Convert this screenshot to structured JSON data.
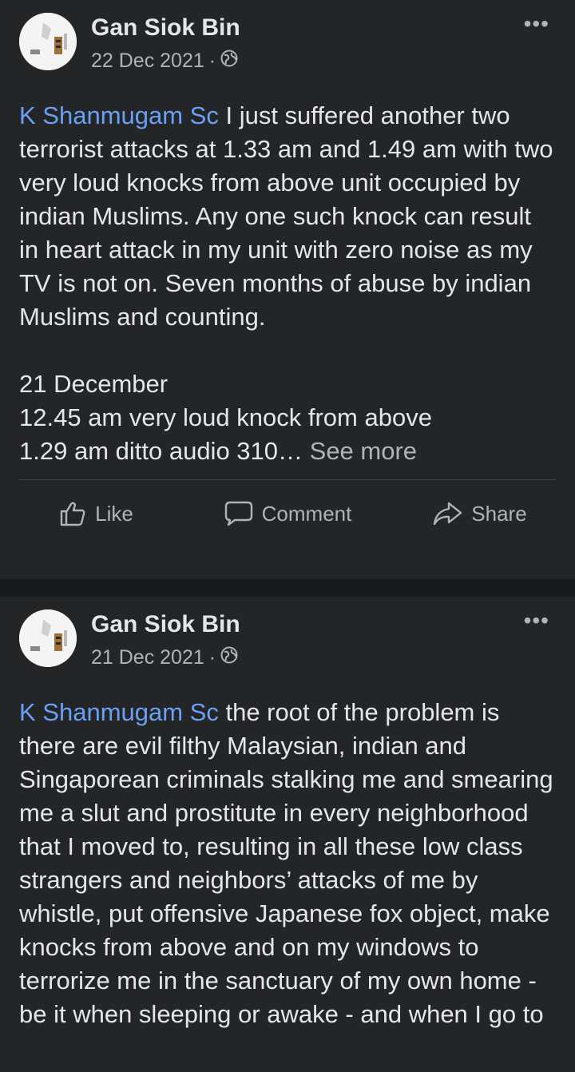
{
  "posts": [
    {
      "author": "Gan Siok Bin",
      "date": "22 Dec 2021",
      "separator": "·",
      "more_label": "•••",
      "mention": "K Shanmugam Sc",
      "text": " I just suffered another two terrorist attacks at 1.33 am and 1.49 am with two very loud knocks from above unit occupied by indian Muslims. Any one such knock can result in heart attack in my unit with zero noise as my TV is not on. Seven months of abuse by indian Muslims and counting.\n\n21 December\n12.45 am very loud knock from above\n1.29 am ditto audio 310… ",
      "see_more": "See more",
      "actions": {
        "like": "Like",
        "comment": "Comment",
        "share": "Share"
      }
    },
    {
      "author": "Gan Siok Bin",
      "date": "21 Dec 2021",
      "separator": "·",
      "more_label": "•••",
      "mention": "K Shanmugam Sc",
      "text": " the root of the problem is there are evil filthy Malaysian, indian and Singaporean criminals stalking me and smearing me a slut and prostitute in every neighborhood that I moved to, resulting in all these low class strangers and neighbors’ attacks of me by whistle, put offensive Japanese fox object, make knocks from above and on my windows to terrorize me in the sanctuary of my own home - be it when sleeping or awake - and when I go to"
    }
  ],
  "icons": [
    "globe-icon",
    "like-icon",
    "comment-icon",
    "share-icon",
    "more-options-icon"
  ]
}
